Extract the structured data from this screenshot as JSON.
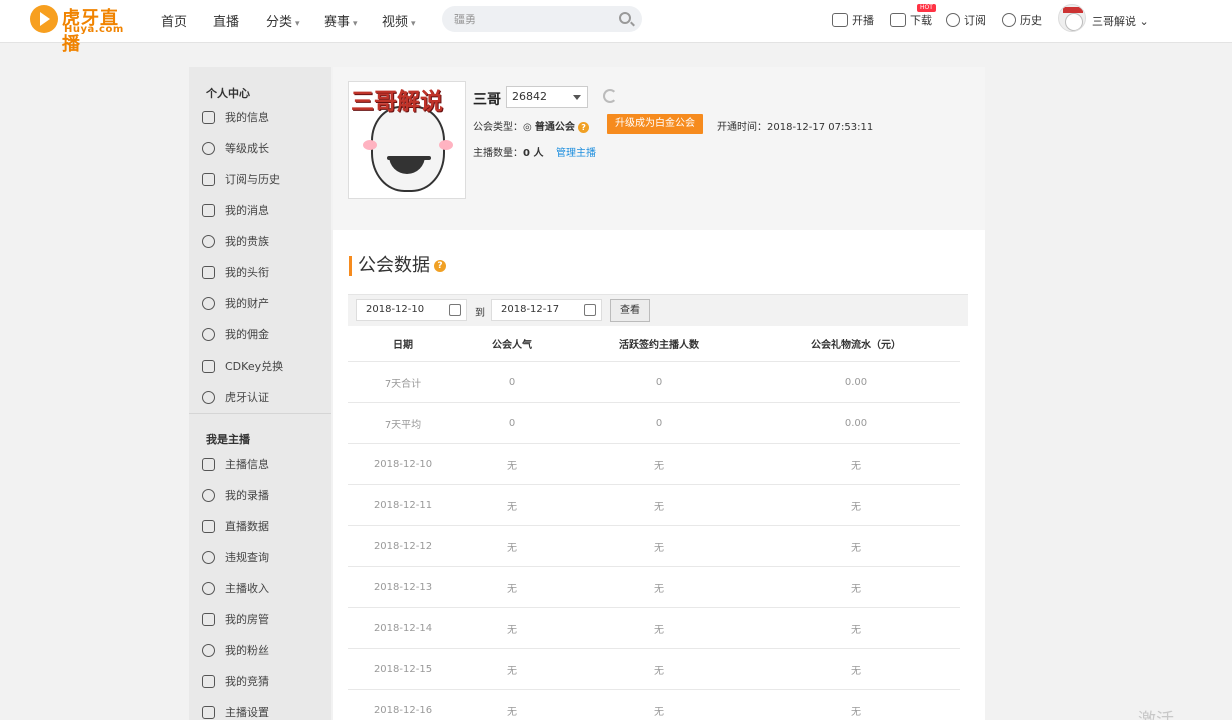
{
  "header": {
    "logo_text": "虎牙直播",
    "logo_sub": "Huya.com",
    "nav": [
      {
        "label": "首页"
      },
      {
        "label": "直播"
      },
      {
        "label": "分类",
        "has_dropdown": true
      },
      {
        "label": "赛事",
        "has_dropdown": true
      },
      {
        "label": "视频",
        "has_dropdown": true
      }
    ],
    "search_value": "疆勇",
    "actions": [
      {
        "label": "开播",
        "icon": "camera-icon"
      },
      {
        "label": "下载",
        "icon": "download-icon",
        "badge": "HOT"
      },
      {
        "label": "订阅",
        "icon": "heart-icon"
      },
      {
        "label": "历史",
        "icon": "clock-icon"
      }
    ],
    "user_name": "三哥解说"
  },
  "sidebar": {
    "section1_title": "个人中心",
    "section1_items": [
      {
        "label": "我的信息",
        "icon": "home-icon"
      },
      {
        "label": "等级成长",
        "icon": "medal-icon"
      },
      {
        "label": "订阅与历史",
        "icon": "bookmark-icon"
      },
      {
        "label": "我的消息",
        "icon": "message-icon"
      },
      {
        "label": "我的贵族",
        "icon": "target-icon"
      },
      {
        "label": "我的头衔",
        "icon": "crown-icon"
      },
      {
        "label": "我的财产",
        "icon": "wallet-icon"
      },
      {
        "label": "我的佣金",
        "icon": "coin-icon"
      },
      {
        "label": "CDKey兑换",
        "icon": "shuffle-icon"
      },
      {
        "label": "虎牙认证",
        "icon": "shield-icon"
      }
    ],
    "section2_title": "我是主播",
    "section2_items": [
      {
        "label": "主播信息",
        "icon": "id-card-icon"
      },
      {
        "label": "我的录播",
        "icon": "play-icon"
      },
      {
        "label": "直播数据",
        "icon": "chart-icon"
      },
      {
        "label": "违规查询",
        "icon": "info-icon"
      },
      {
        "label": "主播收入",
        "icon": "income-icon"
      },
      {
        "label": "我的房管",
        "icon": "house-icon"
      },
      {
        "label": "我的粉丝",
        "icon": "fans-icon"
      },
      {
        "label": "我的竞猜",
        "icon": "dice-icon"
      },
      {
        "label": "主播设置",
        "icon": "settings-icon"
      }
    ]
  },
  "profile": {
    "avatar_title": "三哥解说",
    "name": "三哥",
    "guild_id": "26842",
    "guild_type_label": "公会类型：",
    "guild_type_value": "普通公会",
    "upgrade_button": "升级成为白金公会",
    "open_time_label": "开通时间：",
    "open_time_value": "2018-12-17 07:53:11",
    "streamer_count_label": "主播数量：",
    "streamer_count_value": "0 人",
    "manage_link": "管理主播"
  },
  "data_section": {
    "title": "公会数据",
    "start_date": "2018-12-10",
    "to_label": "到",
    "end_date": "2018-12-17",
    "query_button": "查看"
  },
  "table": {
    "columns": [
      "日期",
      "公会人气",
      "活跃签约主播人数",
      "公会礼物流水（元）"
    ],
    "rows": [
      [
        "7天合计",
        "0",
        "0",
        "0.00"
      ],
      [
        "7天平均",
        "0",
        "0",
        "0.00"
      ],
      [
        "2018-12-10",
        "无",
        "无",
        "无"
      ],
      [
        "2018-12-11",
        "无",
        "无",
        "无"
      ],
      [
        "2018-12-12",
        "无",
        "无",
        "无"
      ],
      [
        "2018-12-13",
        "无",
        "无",
        "无"
      ],
      [
        "2018-12-14",
        "无",
        "无",
        "无"
      ],
      [
        "2018-12-15",
        "无",
        "无",
        "无"
      ],
      [
        "2018-12-16",
        "无",
        "无",
        "无"
      ]
    ]
  },
  "watermark": "激活 Windo",
  "colors": {
    "accent": "#f68b1e",
    "link": "#1f8fde",
    "sidebar_bg": "#e9e9e9",
    "page_bg": "#f2f2f2"
  }
}
